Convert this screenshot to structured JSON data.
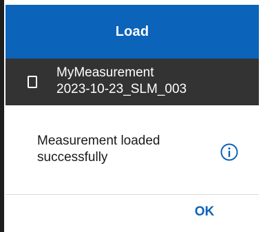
{
  "dialog": {
    "title": "Load",
    "item": {
      "line1": "MyMeasurement",
      "line2": "2023-10-23_SLM_003",
      "icon": "file-icon"
    },
    "message": {
      "line1": "Measurement loaded",
      "line2": "successfully",
      "icon": "info-icon"
    },
    "ok_label": "OK"
  },
  "colors": {
    "header_bg": "#0b63ba",
    "item_bg": "#333333",
    "accent": "#0b63ba"
  }
}
